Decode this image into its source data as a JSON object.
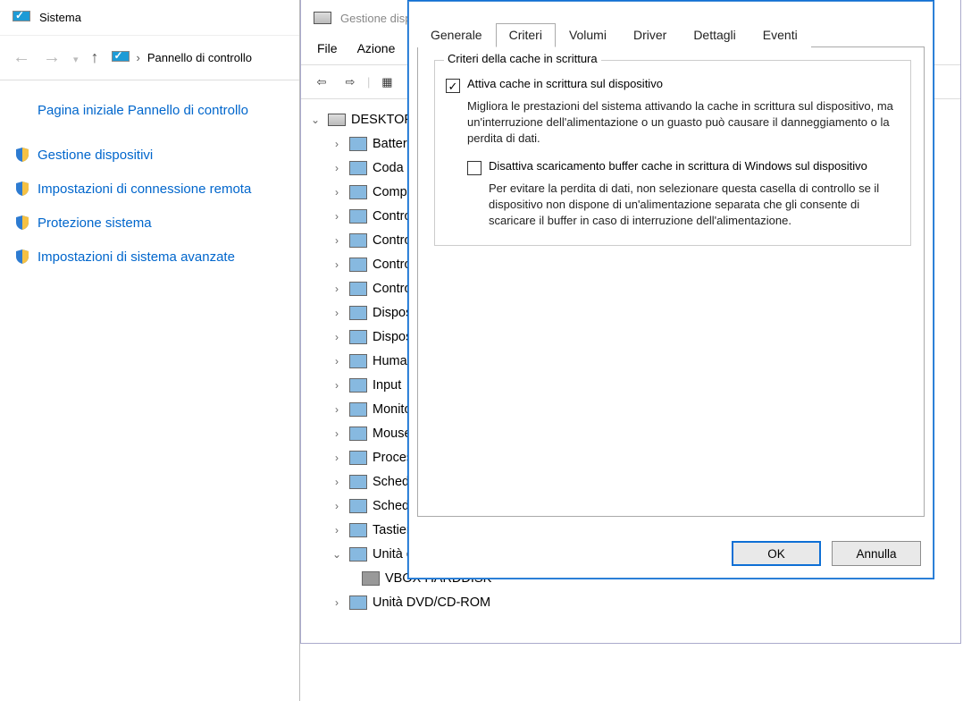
{
  "system_window": {
    "title": "Sistema",
    "breadcrumb_label": "Pannello di controllo",
    "home_link": "Pagina iniziale Pannello di controllo",
    "links": [
      "Gestione dispositivi",
      "Impostazioni di connessione remota",
      "Protezione sistema",
      "Impostazioni di sistema avanzate"
    ]
  },
  "device_manager": {
    "title": "Gestione dispositivi",
    "menu": {
      "file": "File",
      "action": "Azione"
    },
    "root": "DESKTOP",
    "children": [
      {
        "label": "Batterie"
      },
      {
        "label": "Coda di stampa"
      },
      {
        "label": "Computer"
      },
      {
        "label": "Controller"
      },
      {
        "label": "Controller"
      },
      {
        "label": "Controller"
      },
      {
        "label": "Controller"
      },
      {
        "label": "Dispositivi"
      },
      {
        "label": "Dispositivi"
      },
      {
        "label": "Human Interface"
      },
      {
        "label": "Input"
      },
      {
        "label": "Monitor"
      },
      {
        "label": "Mouse"
      },
      {
        "label": "Processori"
      },
      {
        "label": "Schede"
      },
      {
        "label": "Schede"
      },
      {
        "label": "Tastiere"
      },
      {
        "label": "Unità disco",
        "expanded": true,
        "child": "VBOX HARDDISK"
      },
      {
        "label": "Unità DVD/CD-ROM"
      }
    ]
  },
  "dialog": {
    "tabs": {
      "general": "Generale",
      "criteria": "Criteri",
      "volumes": "Volumi",
      "driver": "Driver",
      "details": "Dettagli",
      "events": "Eventi"
    },
    "fieldset_title": "Criteri della cache in scrittura",
    "chk1_label": "Attiva cache in scrittura sul dispositivo",
    "chk1_desc": "Migliora le prestazioni del sistema attivando la cache in scrittura sul dispositivo, ma un'interruzione dell'alimentazione o un guasto può causare il danneggiamento o la perdita di dati.",
    "chk2_label": "Disattiva scaricamento buffer cache in scrittura di Windows sul dispositivo",
    "chk2_desc": "Per evitare la perdita di dati, non selezionare questa casella di controllo se il dispositivo non dispone di un'alimentazione separata che gli consente di scaricare il buffer in caso di interruzione dell'alimentazione.",
    "ok": "OK",
    "cancel": "Annulla"
  }
}
